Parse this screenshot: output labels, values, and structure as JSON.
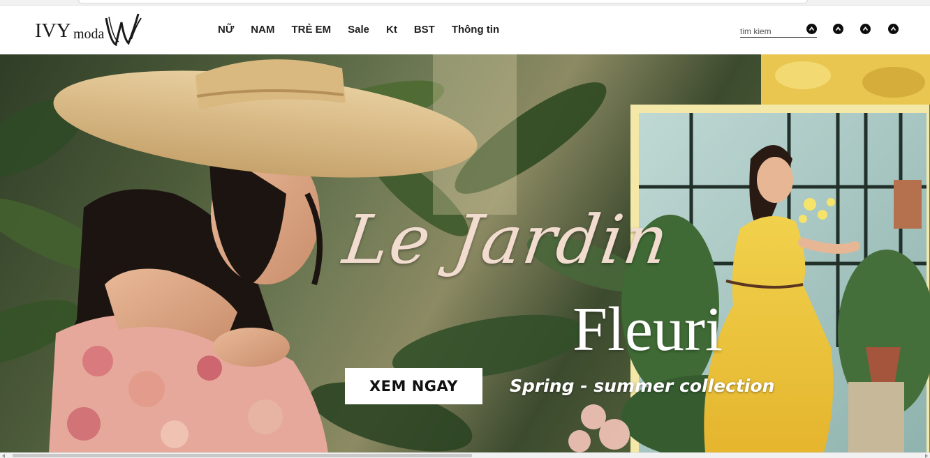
{
  "header": {
    "logo": {
      "brand_text": "IVY",
      "brand_suffix": "moda"
    },
    "nav": [
      {
        "label": "NỮ"
      },
      {
        "label": "NAM"
      },
      {
        "label": "TRẺ EM"
      },
      {
        "label": "Sale"
      },
      {
        "label": "Kt"
      },
      {
        "label": "BST"
      },
      {
        "label": "Thông tin"
      }
    ],
    "search": {
      "placeholder": "tim kiem",
      "value": ""
    },
    "icons": [
      {
        "name": "search-icon"
      },
      {
        "name": "account-icon"
      },
      {
        "name": "help-icon"
      },
      {
        "name": "cart-icon"
      }
    ]
  },
  "hero": {
    "script_title": "Le Jardin",
    "serif_title": "Fleuri",
    "subtitle": "Spring - summer collection",
    "cta_label": "XEM NGAY"
  },
  "colors": {
    "nav_text": "#1f1f1f",
    "icon_bg": "#0d0d0d",
    "script_title": "#f2dcd0",
    "cta_bg": "#ffffff",
    "frame": "#f4e8a8"
  }
}
